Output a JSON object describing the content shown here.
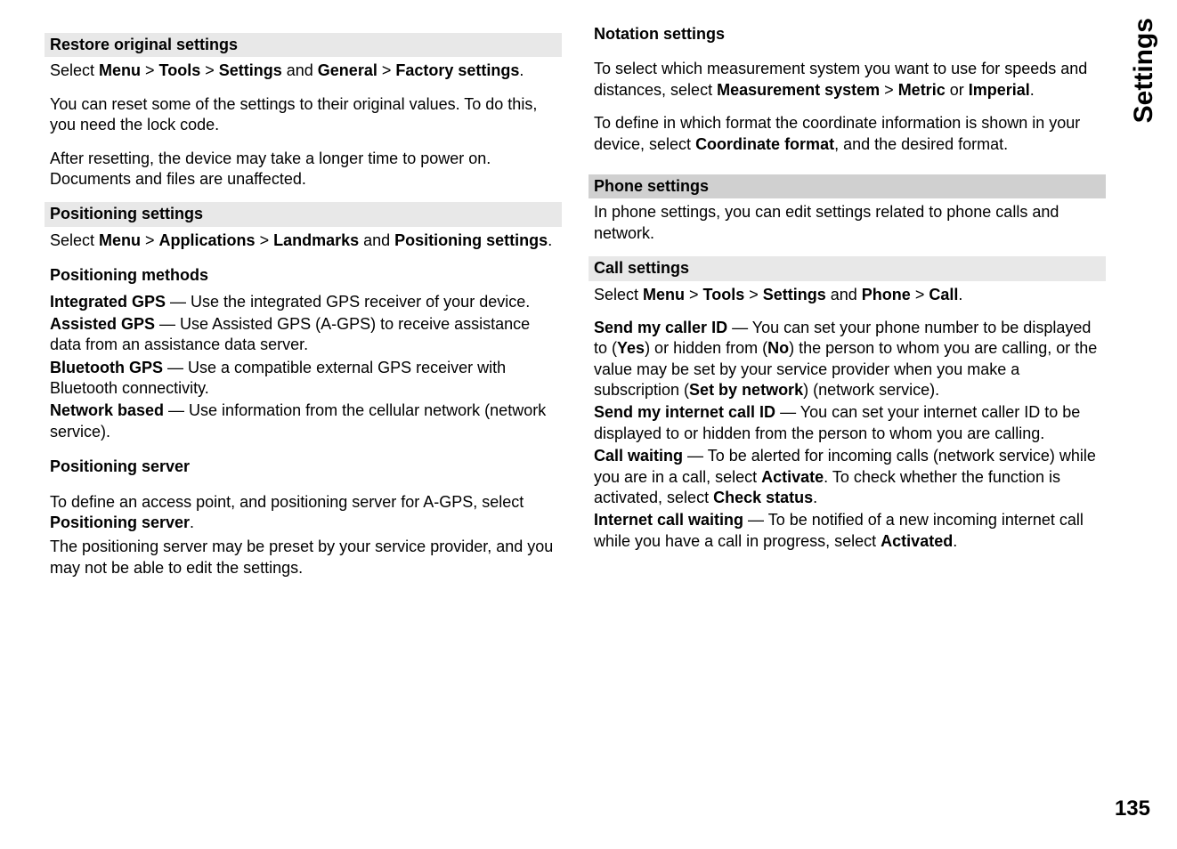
{
  "sideLabel": "Settings",
  "pageNumber": 135,
  "left": {
    "restore": {
      "title": "Restore original settings",
      "p1_a": "Select ",
      "p1_menu": "Menu",
      "p1_gt1": "  > ",
      "p1_tools": "Tools",
      "p1_gt2": "  > ",
      "p1_settings": "Settings",
      "p1_and": " and ",
      "p1_general": "General",
      "p1_gt3": "  > ",
      "p1_factory": "Factory settings",
      "p1_end": ".",
      "p2": "You can reset some of the settings to their original values. To do this, you need the lock code.",
      "p3": "After resetting, the device may take a longer time to power on. Documents and files are unaffected."
    },
    "positioning": {
      "title": "Positioning settings",
      "p1_a": "Select ",
      "p1_menu": "Menu",
      "p1_gt1": "  > ",
      "p1_apps": "Applications",
      "p1_gt2": "  > ",
      "p1_landmarks": "Landmarks",
      "p1_and": " and ",
      "p1_ps": "Positioning settings",
      "p1_end": "."
    },
    "methods": {
      "title": "Positioning methods",
      "igps_t": "Integrated GPS",
      "igps_d": "  — Use the integrated GPS receiver of your device.",
      "agps_t": "Assisted GPS",
      "agps_d": "  — Use Assisted GPS (A-GPS) to receive assistance data from an assistance data server.",
      "bgps_t": "Bluetooth GPS",
      "bgps_d": "  — Use a compatible external GPS receiver with Bluetooth connectivity.",
      "net_t": "Network based",
      "net_d": "  — Use information from the cellular network (network service)."
    },
    "server": {
      "title": "Positioning server",
      "p1_a": "To define an access point, and positioning server for A-GPS, select ",
      "p1_b": "Positioning server",
      "p1_c": ".",
      "p2": "The positioning server may be preset by your service provider, and you may not be able to edit the settings."
    }
  },
  "right": {
    "notation": {
      "title": "Notation settings",
      "p1_a": "To select which measurement system you want to use for speeds and distances, select ",
      "p1_b": "Measurement system",
      "p1_c": "  > ",
      "p1_d": "Metric",
      "p1_e": " or ",
      "p1_f": "Imperial",
      "p1_g": ".",
      "p2_a": "To define in which format the coordinate information is shown in your device, select ",
      "p2_b": "Coordinate format",
      "p2_c": ", and the desired format."
    },
    "phone": {
      "title": "Phone settings",
      "p1": "In phone settings, you can edit settings related to phone calls and network."
    },
    "call": {
      "title": "Call settings",
      "p1_a": "Select ",
      "p1_menu": "Menu",
      "p1_gt1": "  > ",
      "p1_tools": "Tools",
      "p1_gt2": "  > ",
      "p1_settings": "Settings",
      "p1_and": " and ",
      "p1_phone": "Phone",
      "p1_gt3": "  > ",
      "p1_call": "Call",
      "p1_end": ".",
      "cid_t": "Send my caller ID",
      "cid_d1": "  — You can set your phone number to be displayed to (",
      "cid_yes": "Yes",
      "cid_d2": ") or hidden from (",
      "cid_no": "No",
      "cid_d3": ") the person to whom you are calling, or the value may be set by your service provider when you make a subscription (",
      "cid_set": "Set by network",
      "cid_d4": ") (network service).",
      "icid_t": "Send my internet call ID",
      "icid_d": "  — You can set your internet caller ID to be displayed to or hidden from the person to whom you are calling.",
      "cw_t": "Call waiting",
      "cw_d1": "  — To be alerted for incoming calls (network service) while you are in a call, select ",
      "cw_act": "Activate",
      "cw_d2": ". To check whether the function is activated, select ",
      "cw_chk": "Check status",
      "cw_d3": ".",
      "icw_t": "Internet call waiting",
      "icw_d1": "  — To be notified of a new incoming internet call while you have a call in progress, select ",
      "icw_act": "Activated",
      "icw_d2": "."
    }
  }
}
